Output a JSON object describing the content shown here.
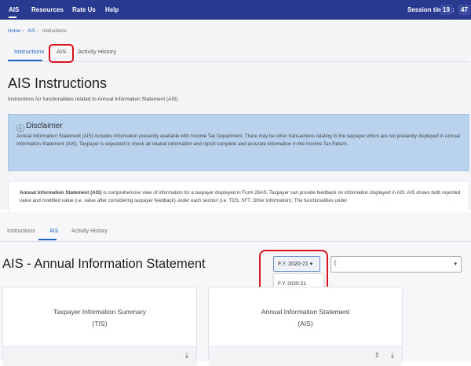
{
  "nav": {
    "items": [
      "AIS",
      "Resources",
      "Rate Us",
      "Help"
    ],
    "session_label": "Session time",
    "session_min": "19",
    "session_sep": ":",
    "session_sec": "47"
  },
  "breadcrumb": [
    "Home",
    "AIS",
    "Instructions"
  ],
  "tabs": [
    "Instructions",
    "AIS",
    "Activity History"
  ],
  "instructions": {
    "title": "AIS Instructions",
    "subtitle": "Instructions for functionalities related to Annual Information Statement (AIS)",
    "disclaimer_title": "Disclaimer",
    "disclaimer_text": "Annual Information Statement (AIS) includes information presently available with Income Tax Department. There may be other transactions relating to the taxpayer which are not presently displayed in Annual Information Statement (AIS). Taxpayer is expected to check all related information and report complete and accurate information in the Income Tax Return.",
    "about_bold": "Annual Information Statement (AIS)",
    "about_text": " is comprehensive view of information for a taxpayer displayed in Form 26AS. Taxpayer can provide feedback on information displayed in AIS. AIS shows both reported value and modified value (i.e. value after considering taxpayer feedback) under each section (i.e. TDS, SFT, Other information). The functionalities under"
  },
  "ais": {
    "title": "AIS - Annual Information Statement",
    "fy_selected": "F.Y. 2020-21",
    "fy_options": [
      "F.Y. 2020-21"
    ],
    "second_select_value": "(",
    "cards": [
      {
        "title": "Taxpayer Information Summary",
        "abbr": "(TIS)"
      },
      {
        "title": "Annual Information Statement",
        "abbr": "(AIS)"
      }
    ]
  },
  "colors": {
    "nav": "#2a3990",
    "accent": "#1e63c6",
    "highlight": "#d9121f",
    "disclaimer_bg": "#b9d3ee"
  }
}
